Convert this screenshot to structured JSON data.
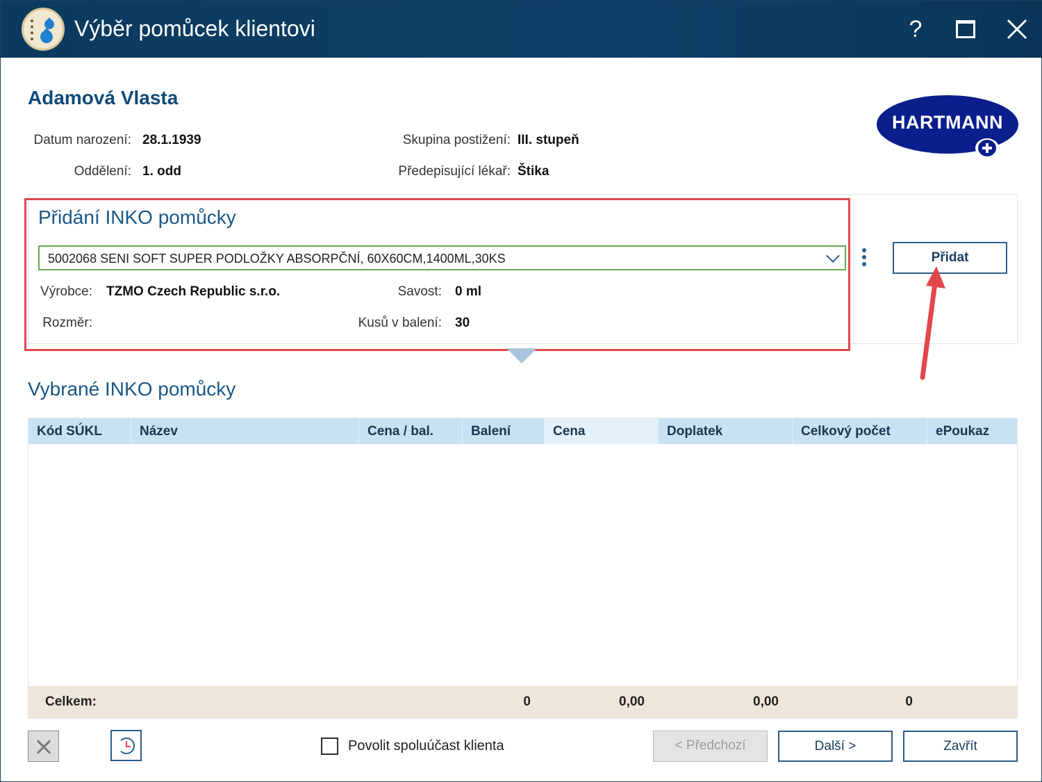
{
  "window": {
    "title": "Výběr pomůcek klientovi",
    "help_label": "?",
    "close_label": "✕"
  },
  "client": {
    "name": "Adamová Vlasta",
    "birth_label": "Datum narození:",
    "birth_value": "28.1.1939",
    "department_label": "Oddělení:",
    "department_value": "1. odd",
    "group_label": "Skupina postižení:",
    "group_value": "III. stupeň",
    "doctor_label": "Předepisující lékař:",
    "doctor_value": "Štika"
  },
  "brand": {
    "logo_text": "HARTMANN"
  },
  "add_panel": {
    "title": "Přidání INKO pomůcky",
    "selected_product": "5002068 SENI SOFT SUPER PODLOŽKY ABSORPČNÍ, 60X60CM,1400ML,30KS",
    "manufacturer_label": "Výrobce:",
    "manufacturer_value": "TZMO Czech Republic s.r.o.",
    "absorbency_label": "Savost:",
    "absorbency_value": "0 ml",
    "size_label": "Rozměr:",
    "size_value": "",
    "pieces_label": "Kusů v balení:",
    "pieces_value": "30",
    "add_button": "Přidat"
  },
  "selected": {
    "title": "Vybrané INKO pomůcky",
    "columns": [
      "Kód SÚKL",
      "Název",
      "Cena / bal.",
      "Balení",
      "Cena",
      "Doplatek",
      "Celkový počet",
      "ePoukaz"
    ],
    "rows": [],
    "totals": {
      "label": "Celkem:",
      "baleni": "0",
      "cena": "0,00",
      "doplatek": "0,00",
      "celkovy_pocet": "0"
    }
  },
  "footer": {
    "allow_copay_label": "Povolit spoluúčast klienta",
    "allow_copay_checked": false,
    "prev_button": "< Předchozí",
    "next_button": "Další >",
    "close_button": "Zavřít"
  },
  "colors": {
    "titlebar": "#0b3a5e",
    "accent_blue": "#1a5787",
    "highlight_red": "#e0474b",
    "table_header": "#c8e2f4",
    "table_footer": "#efe6da"
  }
}
